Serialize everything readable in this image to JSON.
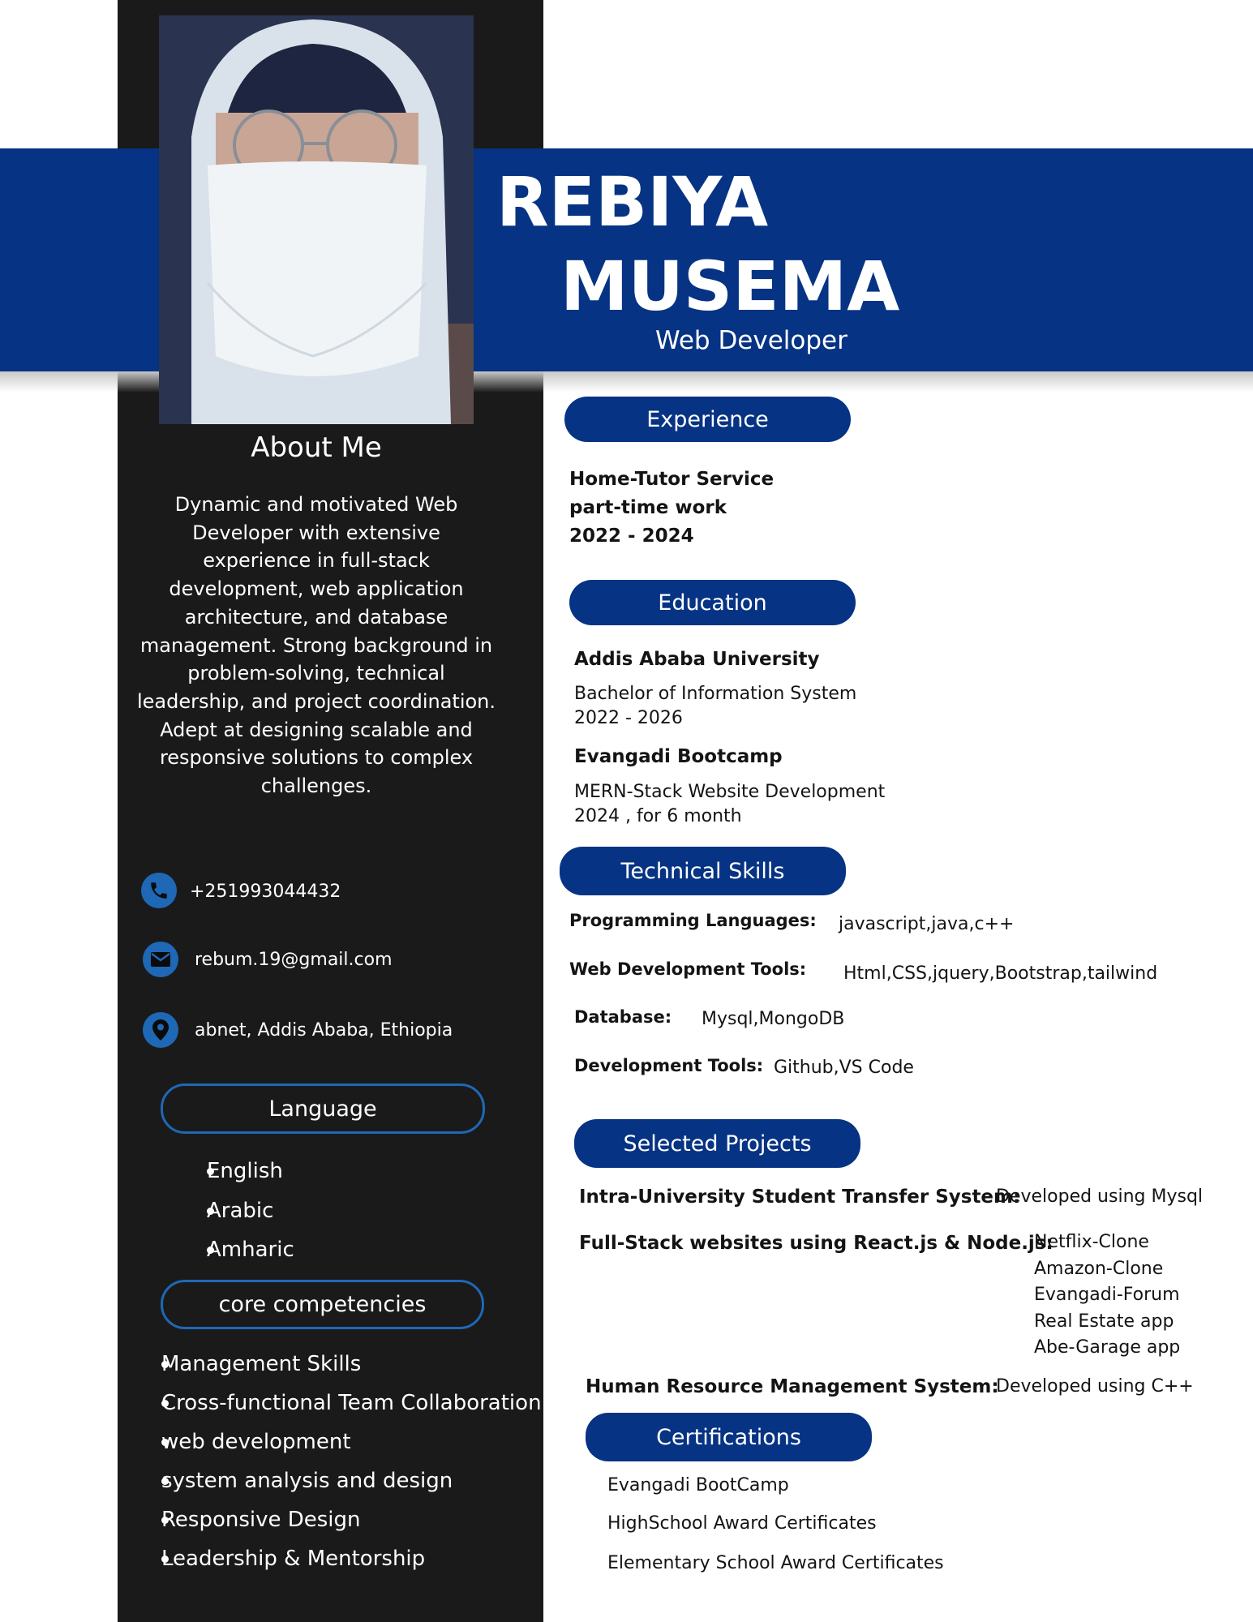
{
  "header": {
    "first_name": "REBIYA",
    "last_name": "MUSEMA",
    "title": "Web Developer"
  },
  "colors": {
    "accent": "#063383",
    "sidebar": "#1a1a1a",
    "icon_blue": "#1e68b6"
  },
  "about": {
    "heading": "About Me",
    "text": "Dynamic and motivated Web Developer with extensive experience in full-stack development, web application architecture, and database management. Strong background in problem-solving, technical leadership, and project coordination. Adept at designing scalable and responsive solutions to complex challenges."
  },
  "contact": {
    "phone": "+251993044432",
    "email": "rebum.19@gmail.com",
    "address": "abnet, Addis Ababa, Ethiopia",
    "icons": [
      "phone-icon",
      "mail-icon",
      "location-pin-icon"
    ]
  },
  "language": {
    "heading": "Language",
    "items": [
      "English",
      "Arabic",
      "Amharic"
    ]
  },
  "competencies": {
    "heading": "core competencies",
    "items": [
      "Management Skills",
      "Cross-functional Team Collaboration",
      "web development",
      "system analysis and design",
      "Responsive Design",
      "Leadership & Mentorship"
    ]
  },
  "experience": {
    "heading": "Experience",
    "place": "Home-Tutor Service",
    "type": "part-time work",
    "years": "2022 - 2024"
  },
  "education": {
    "heading": "Education",
    "items": [
      {
        "school": "Addis Ababa University",
        "program": "Bachelor of Information System",
        "years": "2022 - 2026"
      },
      {
        "school": "Evangadi Bootcamp",
        "program": "MERN-Stack Website Development",
        "years": "2024 , for 6 month"
      }
    ]
  },
  "skills": {
    "heading": "Technical Skills",
    "items": [
      {
        "label": "Programming Languages:",
        "value": "javascript,java,c++"
      },
      {
        "label": "Web Development Tools:",
        "value": "Html,CSS,jquery,Bootstrap,tailwind"
      },
      {
        "label": "Database:",
        "value": "Mysql,MongoDB"
      },
      {
        "label": "Development Tools:",
        "value": "Github,VS Code"
      }
    ]
  },
  "projects": {
    "heading": "Selected Projects",
    "p1": {
      "name": "Intra-University Student Transfer System:",
      "desc": "Developed using Mysql"
    },
    "p2": {
      "name": "Full-Stack websites using React.js & Node.js:",
      "list": [
        "Netflix-Clone",
        "Amazon-Clone",
        "Evangadi-Forum",
        "Real Estate app",
        "Abe-Garage app"
      ]
    },
    "p3": {
      "name": "Human Resource Management System:",
      "desc": "Developed using C++"
    }
  },
  "certifications": {
    "heading": "Certifications",
    "items": [
      "Evangadi BootCamp",
      "HighSchool Award Certificates",
      "Elementary School Award Certificates"
    ]
  }
}
